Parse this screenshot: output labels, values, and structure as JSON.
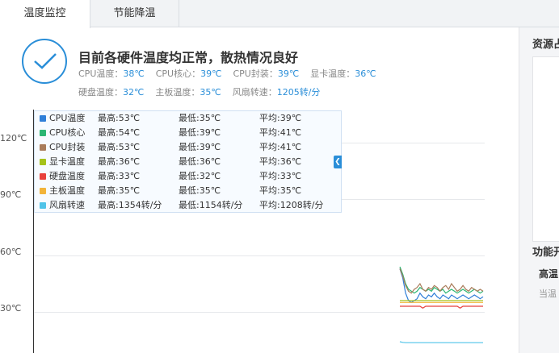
{
  "tabs": [
    {
      "label": "温度监控",
      "active": true
    },
    {
      "label": "节能降温",
      "active": false
    }
  ],
  "status": {
    "title": "目前各硬件温度均正常，散热情况良好",
    "icon": "check-icon",
    "accent": "#2a8ed8",
    "row1": [
      {
        "label": "CPU温度：",
        "value": "38℃"
      },
      {
        "label": "CPU核心：",
        "value": "39℃"
      },
      {
        "label": "CPU封装：",
        "value": "39℃"
      },
      {
        "label": "显卡温度：",
        "value": "36℃"
      }
    ],
    "row2": [
      {
        "label": "硬盘温度：",
        "value": "32℃"
      },
      {
        "label": "主板温度：",
        "value": "35℃"
      },
      {
        "label": "风扇转速：",
        "value": "1205转/分"
      }
    ]
  },
  "chart_data": {
    "type": "line",
    "y_ticks": [
      "120℃",
      "90℃",
      "60℃",
      "30℃"
    ],
    "y_tick_values": [
      120,
      90,
      60,
      30
    ],
    "ylim": [
      0,
      130
    ],
    "grid": true,
    "legend_placement": "top-left",
    "series": [
      {
        "name": "CPU温度",
        "color": "#2f7fd8",
        "max": "最高:53℃",
        "min": "最低:35℃",
        "avg": "平均:39℃",
        "values": [
          53,
          48,
          40,
          36,
          35,
          36,
          37,
          40,
          38,
          37,
          39,
          38,
          40,
          38,
          37,
          39,
          38,
          37,
          39,
          38,
          37,
          38,
          39,
          38,
          37,
          38,
          39,
          38,
          37,
          38
        ]
      },
      {
        "name": "CPU核心",
        "color": "#2bb673",
        "max": "最高:54℃",
        "min": "最低:39℃",
        "avg": "平均:41℃",
        "values": [
          54,
          50,
          45,
          42,
          41,
          40,
          41,
          43,
          42,
          41,
          42,
          41,
          43,
          42,
          41,
          42,
          40,
          41,
          42,
          41,
          40,
          41,
          42,
          41,
          40,
          41,
          42,
          41,
          40,
          41
        ]
      },
      {
        "name": "CPU封装",
        "color": "#a97c5a",
        "max": "最高:53℃",
        "min": "最低:39℃",
        "avg": "平均:41℃",
        "values": [
          53,
          49,
          44,
          41,
          40,
          42,
          43,
          45,
          42,
          41,
          43,
          42,
          44,
          43,
          41,
          43,
          44,
          42,
          45,
          43,
          41,
          42,
          44,
          42,
          41,
          43,
          42,
          41,
          42,
          41
        ]
      },
      {
        "name": "显卡温度",
        "color": "#a5c21a",
        "max": "最高:36℃",
        "min": "最低:36℃",
        "avg": "平均:36℃",
        "values": [
          36,
          36,
          36,
          36,
          36,
          36,
          36,
          36,
          36,
          36,
          36,
          36,
          36,
          36,
          36,
          36,
          36,
          36,
          36,
          36,
          36,
          36,
          36,
          36,
          36,
          36,
          36,
          36,
          36,
          36
        ]
      },
      {
        "name": "硬盘温度",
        "color": "#e8413c",
        "max": "最高:33℃",
        "min": "最低:32℃",
        "avg": "平均:33℃",
        "values": [
          33,
          33,
          33,
          33,
          33,
          33,
          33,
          33,
          32,
          33,
          33,
          33,
          33,
          33,
          33,
          33,
          33,
          33,
          33,
          33,
          33,
          32,
          33,
          33,
          33,
          33,
          33,
          33,
          33,
          33
        ]
      },
      {
        "name": "主板温度",
        "color": "#f2b43a",
        "max": "最高:35℃",
        "min": "最低:35℃",
        "avg": "平均:35℃",
        "values": [
          35,
          35,
          35,
          35,
          35,
          35,
          35,
          35,
          35,
          35,
          35,
          35,
          35,
          35,
          35,
          35,
          35,
          35,
          35,
          35,
          35,
          35,
          35,
          35,
          35,
          35,
          35,
          35,
          35,
          35
        ]
      },
      {
        "name": "风扇转速",
        "color": "#4fc3e8",
        "max": "最高:1354转/分",
        "min": "最低:1154转/分",
        "avg": "平均:1208转/分",
        "values": [
          4,
          3,
          2.5,
          2.5,
          2.5,
          2.5,
          2.5,
          2.5,
          2.5,
          2.5,
          2.5,
          2.5,
          2.5,
          2.5,
          2.5,
          2.5,
          2.5,
          2.5,
          2.5,
          2.5,
          2.5,
          2.5,
          2.5,
          2.5,
          2.5,
          2.5,
          2.5,
          2.5,
          2.5,
          2.5
        ]
      }
    ]
  },
  "legend_toggle_icon": "chevron-left-icon",
  "right_panel": {
    "title1": "资源占",
    "title2": "功能开",
    "sub": "高温",
    "desc": "当温"
  }
}
